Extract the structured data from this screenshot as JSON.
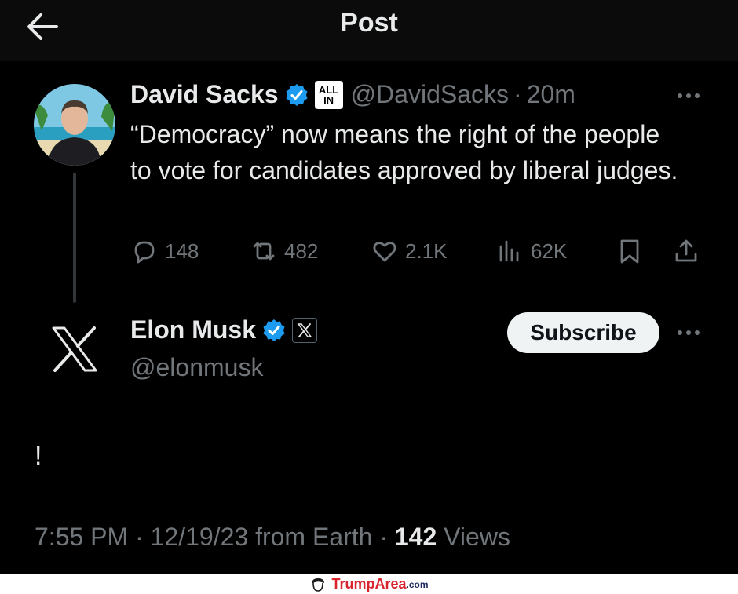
{
  "header": {
    "title": "Post",
    "back_icon": "arrow-left-icon"
  },
  "parent_post": {
    "author_name": "David Sacks",
    "affiliation_badge_line1": "ALL",
    "affiliation_badge_line2": "IN",
    "handle": "@DavidSacks",
    "separator": "·",
    "time": "20m",
    "text": "“Democracy” now means the right of the people to vote for candidates approved by liberal judges.",
    "actions": {
      "replies": "148",
      "reposts": "482",
      "likes": "2.1K",
      "views": "62K"
    }
  },
  "reply_post": {
    "author_name": "Elon Musk",
    "handle": "@elonmusk",
    "subscribe_label": "Subscribe",
    "text": "!",
    "meta": {
      "time": "7:55 PM",
      "separator": "·",
      "date": "12/19/23 from Earth",
      "views_count": "142",
      "views_label": "Views"
    }
  },
  "watermark": {
    "brand": "TrumpArea",
    "suffix": ".com"
  },
  "colors": {
    "background": "#000000",
    "text_primary": "#e7e9ea",
    "text_secondary": "#71767b",
    "verified_blue": "#1d9bf0",
    "button_bg": "#eff3f4"
  }
}
